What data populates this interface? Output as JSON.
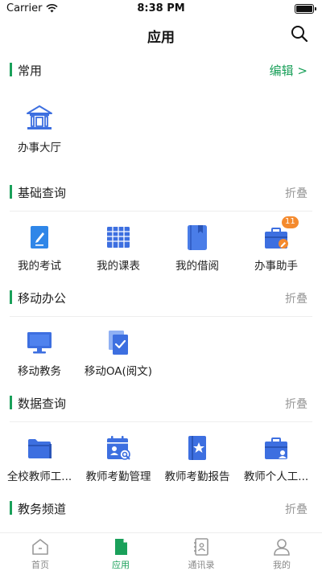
{
  "status_bar": {
    "carrier": "Carrier",
    "time": "8:38 PM"
  },
  "nav": {
    "title": "应用"
  },
  "sections": [
    {
      "title": "常用",
      "action": "编辑 >",
      "items": [
        {
          "label": "办事大厅",
          "icon": "building-icon"
        }
      ]
    },
    {
      "title": "基础查询",
      "action": "折叠",
      "items": [
        {
          "label": "我的考试",
          "icon": "exam-icon"
        },
        {
          "label": "我的课表",
          "icon": "timetable-icon"
        },
        {
          "label": "我的借阅",
          "icon": "book-icon"
        },
        {
          "label": "办事助手",
          "icon": "briefcase-edit-icon",
          "badge": "11"
        }
      ]
    },
    {
      "title": "移动办公",
      "action": "折叠",
      "items": [
        {
          "label": "移动教务",
          "icon": "monitor-icon"
        },
        {
          "label": "移动OA(阅文)",
          "icon": "documents-check-icon"
        }
      ]
    },
    {
      "title": "数据查询",
      "action": "折叠",
      "items": [
        {
          "label": "全校教师工...",
          "icon": "folder-icon"
        },
        {
          "label": "教师考勤管理",
          "icon": "attendance-icon"
        },
        {
          "label": "教师考勤报告",
          "icon": "report-star-icon"
        },
        {
          "label": "教师个人工...",
          "icon": "briefcase-person-icon"
        }
      ]
    },
    {
      "title": "教务频道",
      "action": "折叠",
      "items": []
    }
  ],
  "tabs": [
    {
      "label": "首页",
      "icon": "home-icon",
      "active": false
    },
    {
      "label": "应用",
      "icon": "app-doc-icon",
      "active": true
    },
    {
      "label": "通讯录",
      "icon": "contacts-icon",
      "active": false
    },
    {
      "label": "我的",
      "icon": "profile-icon",
      "active": false
    }
  ],
  "colors": {
    "accent": "#1aa05a",
    "icon_blue": "#3d6fe0",
    "badge": "#f48a2e"
  }
}
